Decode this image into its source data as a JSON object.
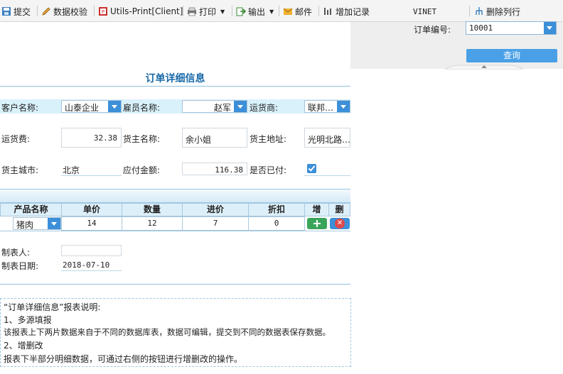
{
  "toolbar": {
    "submit": "提交",
    "validate": "数据校验",
    "utils_print": "Utils-Print[Client]",
    "print": "打印",
    "export": "输出",
    "email": "邮件",
    "add_record": "增加记录",
    "vinet": "VINET",
    "delete_row": "删除列行"
  },
  "query": {
    "order_label": "订单编号:",
    "order_value": "10001",
    "query_button": "查询"
  },
  "report": {
    "title": "订单详细信息",
    "customer_label": "客户名称:",
    "customer_value": "山泰企业",
    "employee_label": "雇员名称:",
    "employee_value": "赵军",
    "shipper_label": "运货商:",
    "shipper_value": "联邦…",
    "freight_label": "运货费:",
    "freight_value": "32.38",
    "consignee_label": "货主名称:",
    "consignee_value": "余小姐",
    "address_label": "货主地址:",
    "address_value": "光明北路…",
    "city_label": "货主城市:",
    "city_value": "北京",
    "amount_label": "应付金额:",
    "amount_value": "116.38",
    "paid_label": "是否已付:",
    "paid_checked": true
  },
  "grid": {
    "headers": [
      "产品名称",
      "单价",
      "数量",
      "进价",
      "折扣",
      "增",
      "删"
    ],
    "row": {
      "product": "猪肉",
      "price": "14",
      "quantity": "12",
      "cost": "7",
      "discount": "0"
    }
  },
  "footer": {
    "maker_label": "制表人:",
    "maker_value": "",
    "date_label": "制表日期:",
    "date_value": "2018-07-10"
  },
  "note": {
    "lines": [
      "“订单详细信息”报表说明:",
      "1、多源填报",
      "该报表上下两片数据来自于不同的数据库表，数据可编辑，提交到不同的数据表保存数据。",
      "2、增删改",
      "报表下半部分明细数据，可通过右侧的按钮进行增删改的操作。"
    ]
  },
  "colors": {
    "accent": "#3c8fd8",
    "title": "#1a6aa8",
    "band": "#d9f1fb"
  }
}
